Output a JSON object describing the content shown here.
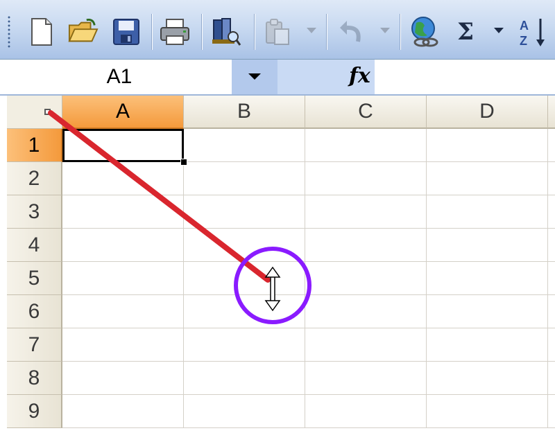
{
  "name_box": {
    "value": "A1"
  },
  "formula_bar": {
    "fx_label": "fx",
    "value": ""
  },
  "toolbar": {
    "buttons": [
      "new-icon",
      "open-icon",
      "save-icon",
      "print-icon",
      "print-preview-icon",
      "paste-icon",
      "undo-icon",
      "hyperlink-icon",
      "autosum-icon",
      "sort-ascending-icon"
    ],
    "autosum_label": "Σ",
    "sort_label": "A↓Z"
  },
  "sheet": {
    "columns": [
      "A",
      "B",
      "C",
      "D"
    ],
    "rows": [
      "1",
      "2",
      "3",
      "4",
      "5",
      "6",
      "7",
      "8",
      "9"
    ],
    "active_cell": "A1",
    "active_column": "A",
    "active_row": "1"
  },
  "annotation": {
    "arrow_color": "#d9262e",
    "circle_color": "#8a1bff",
    "cursor": "row-resize-cursor-icon"
  },
  "colors": {
    "toolbar_bg": "#c9daf1",
    "header_active": "#f49a3c",
    "header_bg": "#ece8db",
    "gridline": "#d4d0c8"
  }
}
